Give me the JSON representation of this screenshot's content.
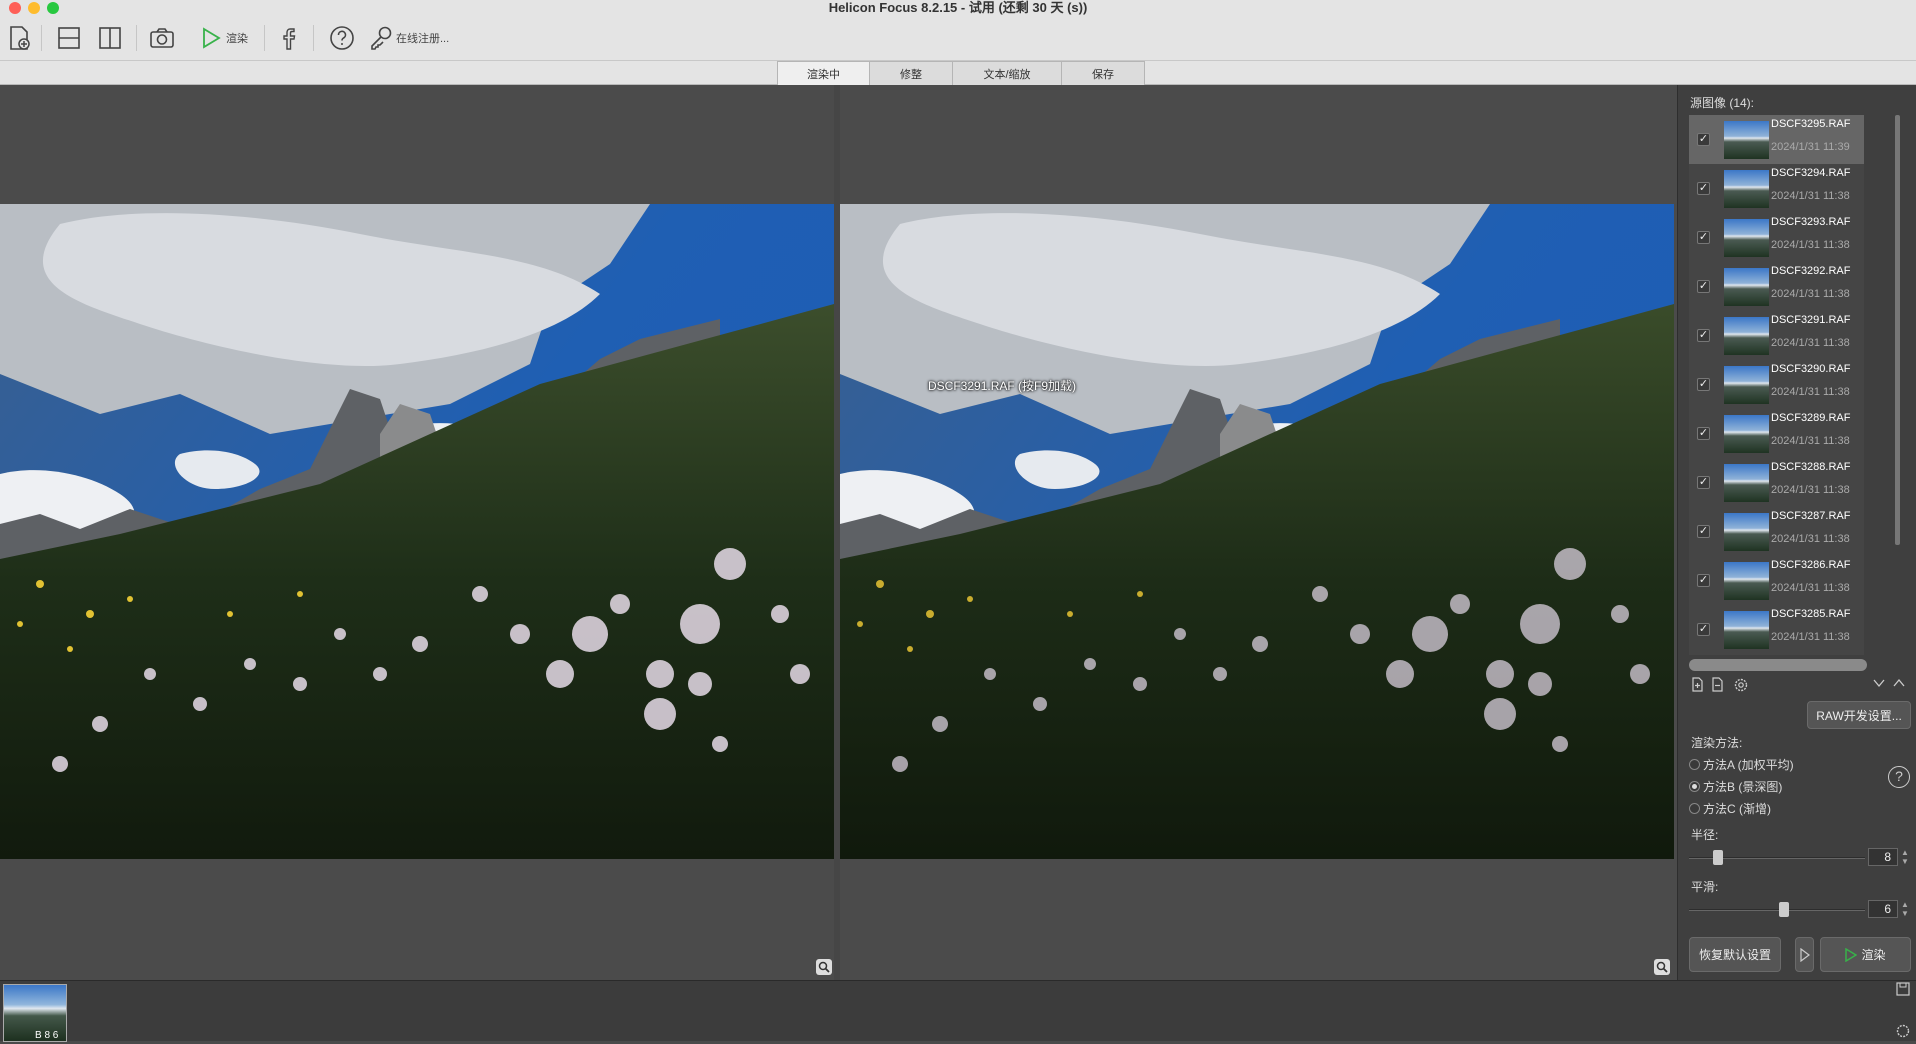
{
  "window": {
    "title": "Helicon Focus 8.2.15 - 试用 (还剩 30 天 (s))"
  },
  "toolbar": {
    "render_label": "渲染",
    "register_label": "在线注册..."
  },
  "tabs": [
    {
      "label": "渲染中",
      "active": true
    },
    {
      "label": "修整",
      "active": false
    },
    {
      "label": "文本/缩放",
      "active": false
    },
    {
      "label": "保存",
      "active": false
    }
  ],
  "viewer": {
    "overlay_label": "DSCF3291.RAF (按F9加载)"
  },
  "source_panel": {
    "header": "源图像 (14):",
    "items": [
      {
        "name": "DSCF3295.RAF",
        "date": "2024/1/31 11:39",
        "selected": true
      },
      {
        "name": "DSCF3294.RAF",
        "date": "2024/1/31 11:38"
      },
      {
        "name": "DSCF3293.RAF",
        "date": "2024/1/31 11:38"
      },
      {
        "name": "DSCF3292.RAF",
        "date": "2024/1/31 11:38"
      },
      {
        "name": "DSCF3291.RAF",
        "date": "2024/1/31 11:38"
      },
      {
        "name": "DSCF3290.RAF",
        "date": "2024/1/31 11:38"
      },
      {
        "name": "DSCF3289.RAF",
        "date": "2024/1/31 11:38"
      },
      {
        "name": "DSCF3288.RAF",
        "date": "2024/1/31 11:38"
      },
      {
        "name": "DSCF3287.RAF",
        "date": "2024/1/31 11:38"
      },
      {
        "name": "DSCF3286.RAF",
        "date": "2024/1/31 11:38"
      },
      {
        "name": "DSCF3285.RAF",
        "date": "2024/1/31 11:38"
      }
    ],
    "raw_button": "RAW开发设置..."
  },
  "render_method": {
    "label": "渲染方法:",
    "options": [
      "方法A (加权平均)",
      "方法B (景深图)",
      "方法C (渐增)"
    ],
    "selected_index": 1
  },
  "params": {
    "radius_label": "半径:",
    "radius_value": "8",
    "smooth_label": "平滑:",
    "smooth_value": "6"
  },
  "buttons": {
    "reset": "恢复默认设置",
    "render": "渲染"
  },
  "filmstrip": {
    "label": "B 8 6"
  }
}
